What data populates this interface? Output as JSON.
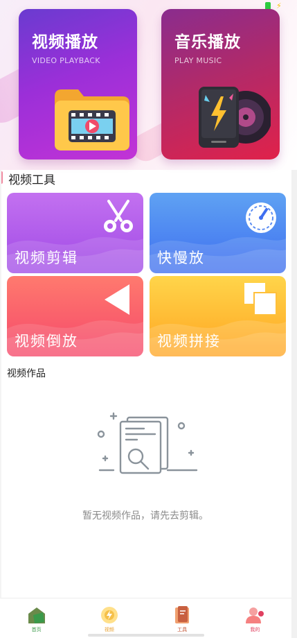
{
  "status": {
    "battery_color": "#2ecc40"
  },
  "hero": [
    {
      "title": "视频播放",
      "subtitle": "VIDEO PLAYBACK",
      "icon": "video-folder-icon"
    },
    {
      "title": "音乐播放",
      "subtitle": "PLAY MUSIC",
      "icon": "music-player-icon"
    }
  ],
  "tools_section": {
    "title": "视频工具"
  },
  "tools": [
    {
      "label": "视频剪辑",
      "icon": "scissors-icon",
      "color": "#a04ae6"
    },
    {
      "label": "快慢放",
      "icon": "speedometer-icon",
      "color": "#3f6ff0"
    },
    {
      "label": "视频倒放",
      "icon": "reverse-triangle-icon",
      "color": "#f5486a"
    },
    {
      "label": "视频拼接",
      "icon": "overlap-squares-icon",
      "color": "#ffa522"
    }
  ],
  "works_section": {
    "title": "视频作品"
  },
  "empty_state": {
    "message": "暂无视频作品，请先去剪辑。",
    "icon": "empty-document-search-icon"
  },
  "tabbar": [
    {
      "label": "首页",
      "icon": "home-icon",
      "color": "#3a9a4a"
    },
    {
      "label": "视频",
      "icon": "video-tab-icon",
      "color": "#e8a030"
    },
    {
      "label": "工具",
      "icon": "tools-tab-icon",
      "color": "#c05030"
    },
    {
      "label": "我的",
      "icon": "profile-icon",
      "color": "#e04060"
    }
  ]
}
